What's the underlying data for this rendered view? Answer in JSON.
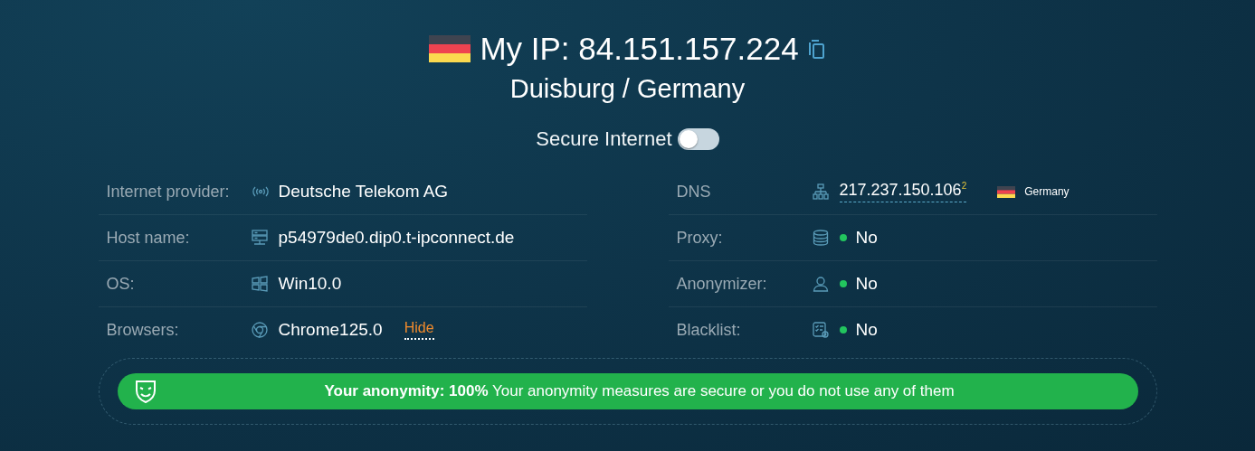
{
  "header": {
    "title": "My IP: 84.151.157.224",
    "location": "Duisburg / Germany"
  },
  "secure_internet": {
    "label": "Secure Internet",
    "on": false
  },
  "left_rows": [
    {
      "kind": "text",
      "label": "Internet provider:",
      "value": "Deutsche Telekom AG"
    },
    {
      "kind": "text",
      "label": "Host name:",
      "value": "p54979de0.dip0.t-ipconnect.de"
    },
    {
      "kind": "text",
      "label": "OS:",
      "value": "Win10.0"
    },
    {
      "kind": "action",
      "label": "Browsers:",
      "value": "Chrome125.0",
      "action": "Hide"
    }
  ],
  "right_rows": [
    {
      "kind": "dns",
      "label": "DNS",
      "value": "217.237.150.106",
      "count": "2",
      "country": "Germany"
    },
    {
      "kind": "status",
      "label": "Proxy:",
      "value": "No",
      "color": "#22c55e"
    },
    {
      "kind": "status",
      "label": "Anonymizer:",
      "value": "No",
      "color": "#22c55e"
    },
    {
      "kind": "status",
      "label": "Blacklist:",
      "value": "No",
      "color": "#22c55e"
    }
  ],
  "banner": {
    "text": "**Your anonymity: 100%** Your anonymity measures are secure or you do not use any of them"
  }
}
